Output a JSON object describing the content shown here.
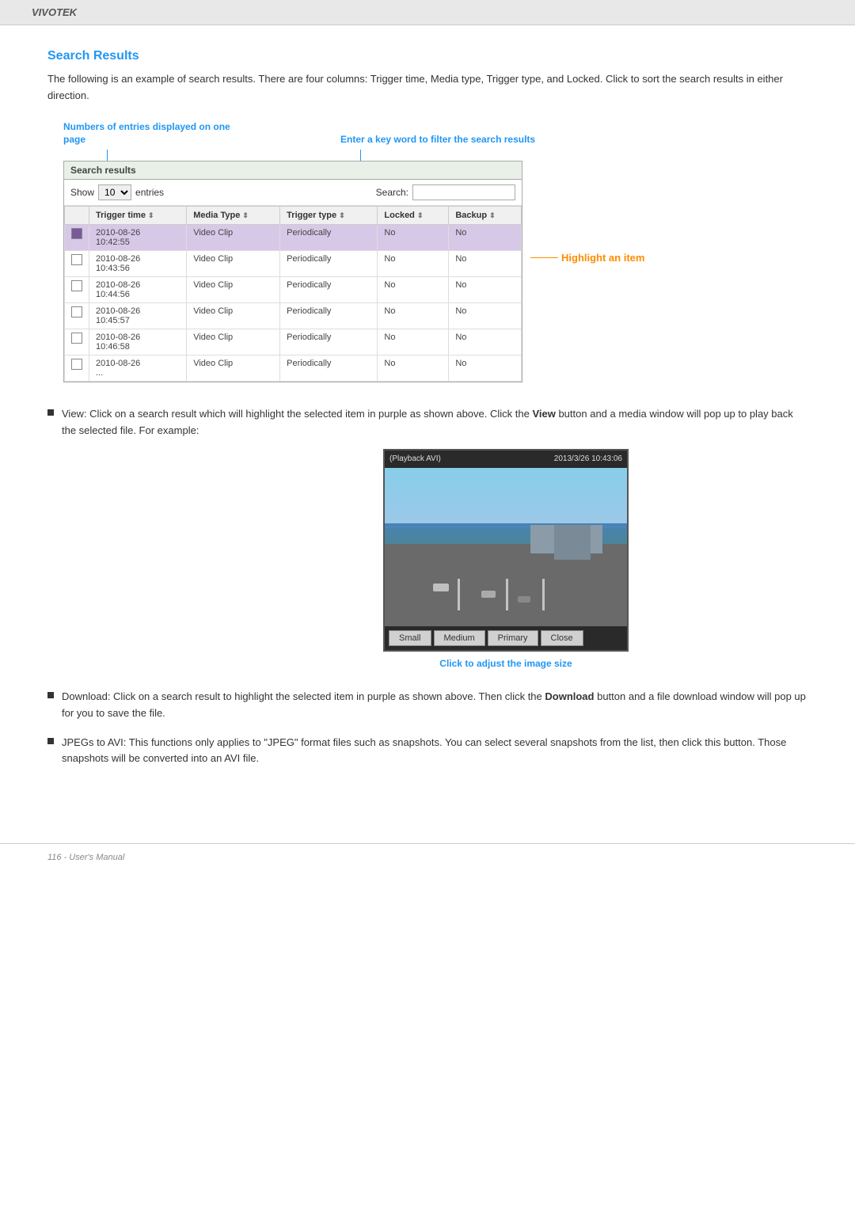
{
  "header": {
    "brand": "VIVOTEK"
  },
  "footer": {
    "page_label": "116 - User's Manual"
  },
  "section": {
    "title": "Search Results",
    "intro": "The following is an example of search results. There are four columns: Trigger time, Media type, Trigger type, and Locked. Click   to sort the search results in either direction."
  },
  "annotations": {
    "entries_label": "Numbers of entries displayed on one page",
    "search_label": "Enter a key word to filter the search results",
    "highlight_label": "Highlight an item"
  },
  "table": {
    "title": "Search results",
    "show_label": "Show",
    "show_value": "10",
    "entries_label": "entries",
    "search_label": "Search:",
    "columns": [
      {
        "label": ""
      },
      {
        "label": "Trigger time"
      },
      {
        "label": "Media Type"
      },
      {
        "label": "Trigger type"
      },
      {
        "label": "Locked"
      },
      {
        "label": "Backup"
      }
    ],
    "rows": [
      {
        "checked": true,
        "trigger_time": "2010-08-26\n10:42:55",
        "media_type": "Video Clip",
        "trigger_type": "Periodically",
        "locked": "No",
        "backup": "No"
      },
      {
        "checked": false,
        "trigger_time": "2010-08-26\n10:43:56",
        "media_type": "Video Clip",
        "trigger_type": "Periodically",
        "locked": "No",
        "backup": "No"
      },
      {
        "checked": false,
        "trigger_time": "2010-08-26\n10:44:56",
        "media_type": "Video Clip",
        "trigger_type": "Periodically",
        "locked": "No",
        "backup": "No"
      },
      {
        "checked": false,
        "trigger_time": "2010-08-26\n10:45:57",
        "media_type": "Video Clip",
        "trigger_type": "Periodically",
        "locked": "No",
        "backup": "No"
      },
      {
        "checked": false,
        "trigger_time": "2010-08-26\n10:46:58",
        "media_type": "Video Clip",
        "trigger_type": "Periodically",
        "locked": "No",
        "backup": "No"
      },
      {
        "checked": false,
        "trigger_time": "2010-08-26\n...",
        "media_type": "Video Clip",
        "trigger_type": "Periodically",
        "locked": "No",
        "backup": "No"
      }
    ]
  },
  "playback": {
    "title": "(Playback AVI)",
    "timestamp": "2013/3/26 10:43:06",
    "buttons": [
      "Small",
      "Medium",
      "Primary",
      "Close"
    ],
    "click_label": "Click to adjust the image size"
  },
  "bullets": [
    {
      "id": "view",
      "text_parts": [
        {
          "bold": false,
          "text": "View: Click on a search result which will highlight the selected item in purple as shown above. Click the "
        },
        {
          "bold": true,
          "text": "View"
        },
        {
          "bold": false,
          "text": " button and a media window will pop up to play back the selected file. For example:"
        }
      ]
    },
    {
      "id": "download",
      "text_parts": [
        {
          "bold": false,
          "text": "Download: Click on a search result to highlight the selected item in purple as shown above. Then click the "
        },
        {
          "bold": true,
          "text": "Download"
        },
        {
          "bold": false,
          "text": " button and a file download window will pop up for you to save the file."
        }
      ]
    },
    {
      "id": "jpegs",
      "text_parts": [
        {
          "bold": false,
          "text": "JPEGs to AVI: This functions only applies to \"JPEG\" format files such as snapshots. You can select several snapshots from the list, then click this button. Those snapshots will be converted into an AVI file."
        }
      ]
    }
  ]
}
